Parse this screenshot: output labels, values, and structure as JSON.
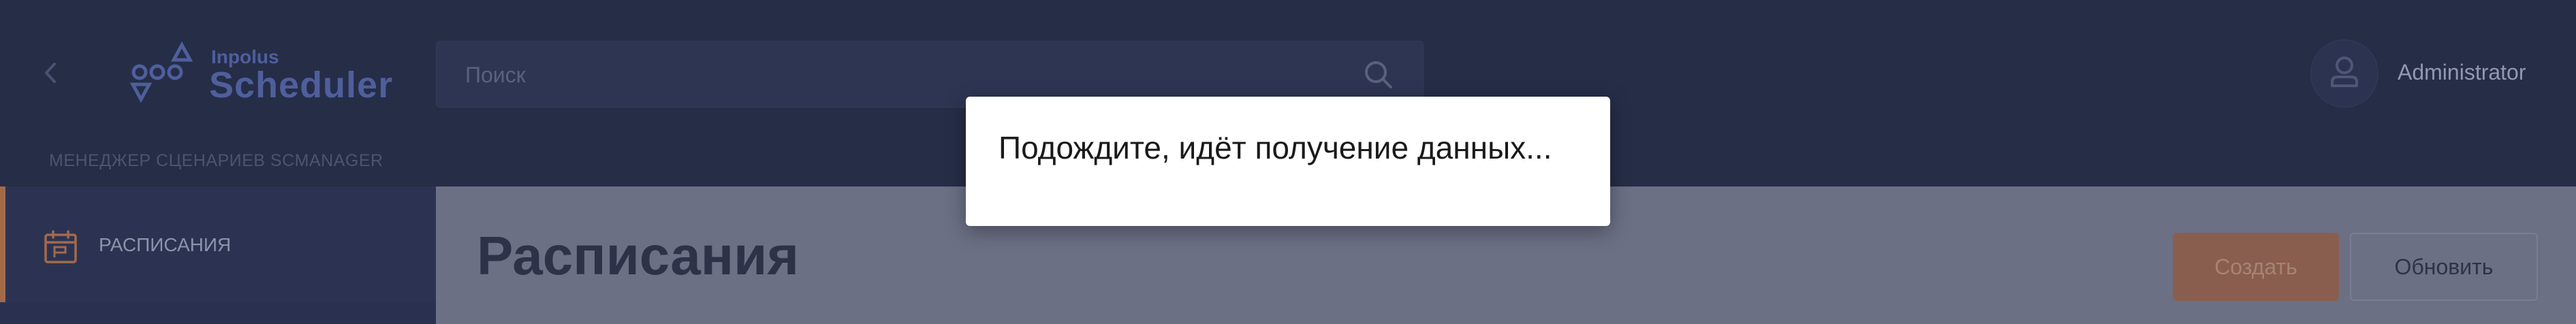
{
  "header": {
    "logo_top": "Inpolus",
    "logo_main": "Scheduler",
    "search_placeholder": "Поиск",
    "user_name": "Administrator"
  },
  "sidebar": {
    "section_title": "МЕНЕДЖЕР СЦЕНАРИЕВ SCMANAGER",
    "items": [
      {
        "label": "РАСПИСАНИЯ",
        "icon": "calendar-icon",
        "active": true
      }
    ]
  },
  "main": {
    "title": "Расписания",
    "create_label": "Создать",
    "refresh_label": "Обновить"
  },
  "dialog": {
    "text": "Подождите, идёт получение данных..."
  },
  "colors": {
    "header_bg": "#262d47",
    "sidebar_bg": "#2a3150",
    "accent": "#a36a4a",
    "logo": "#4f5f9c"
  }
}
